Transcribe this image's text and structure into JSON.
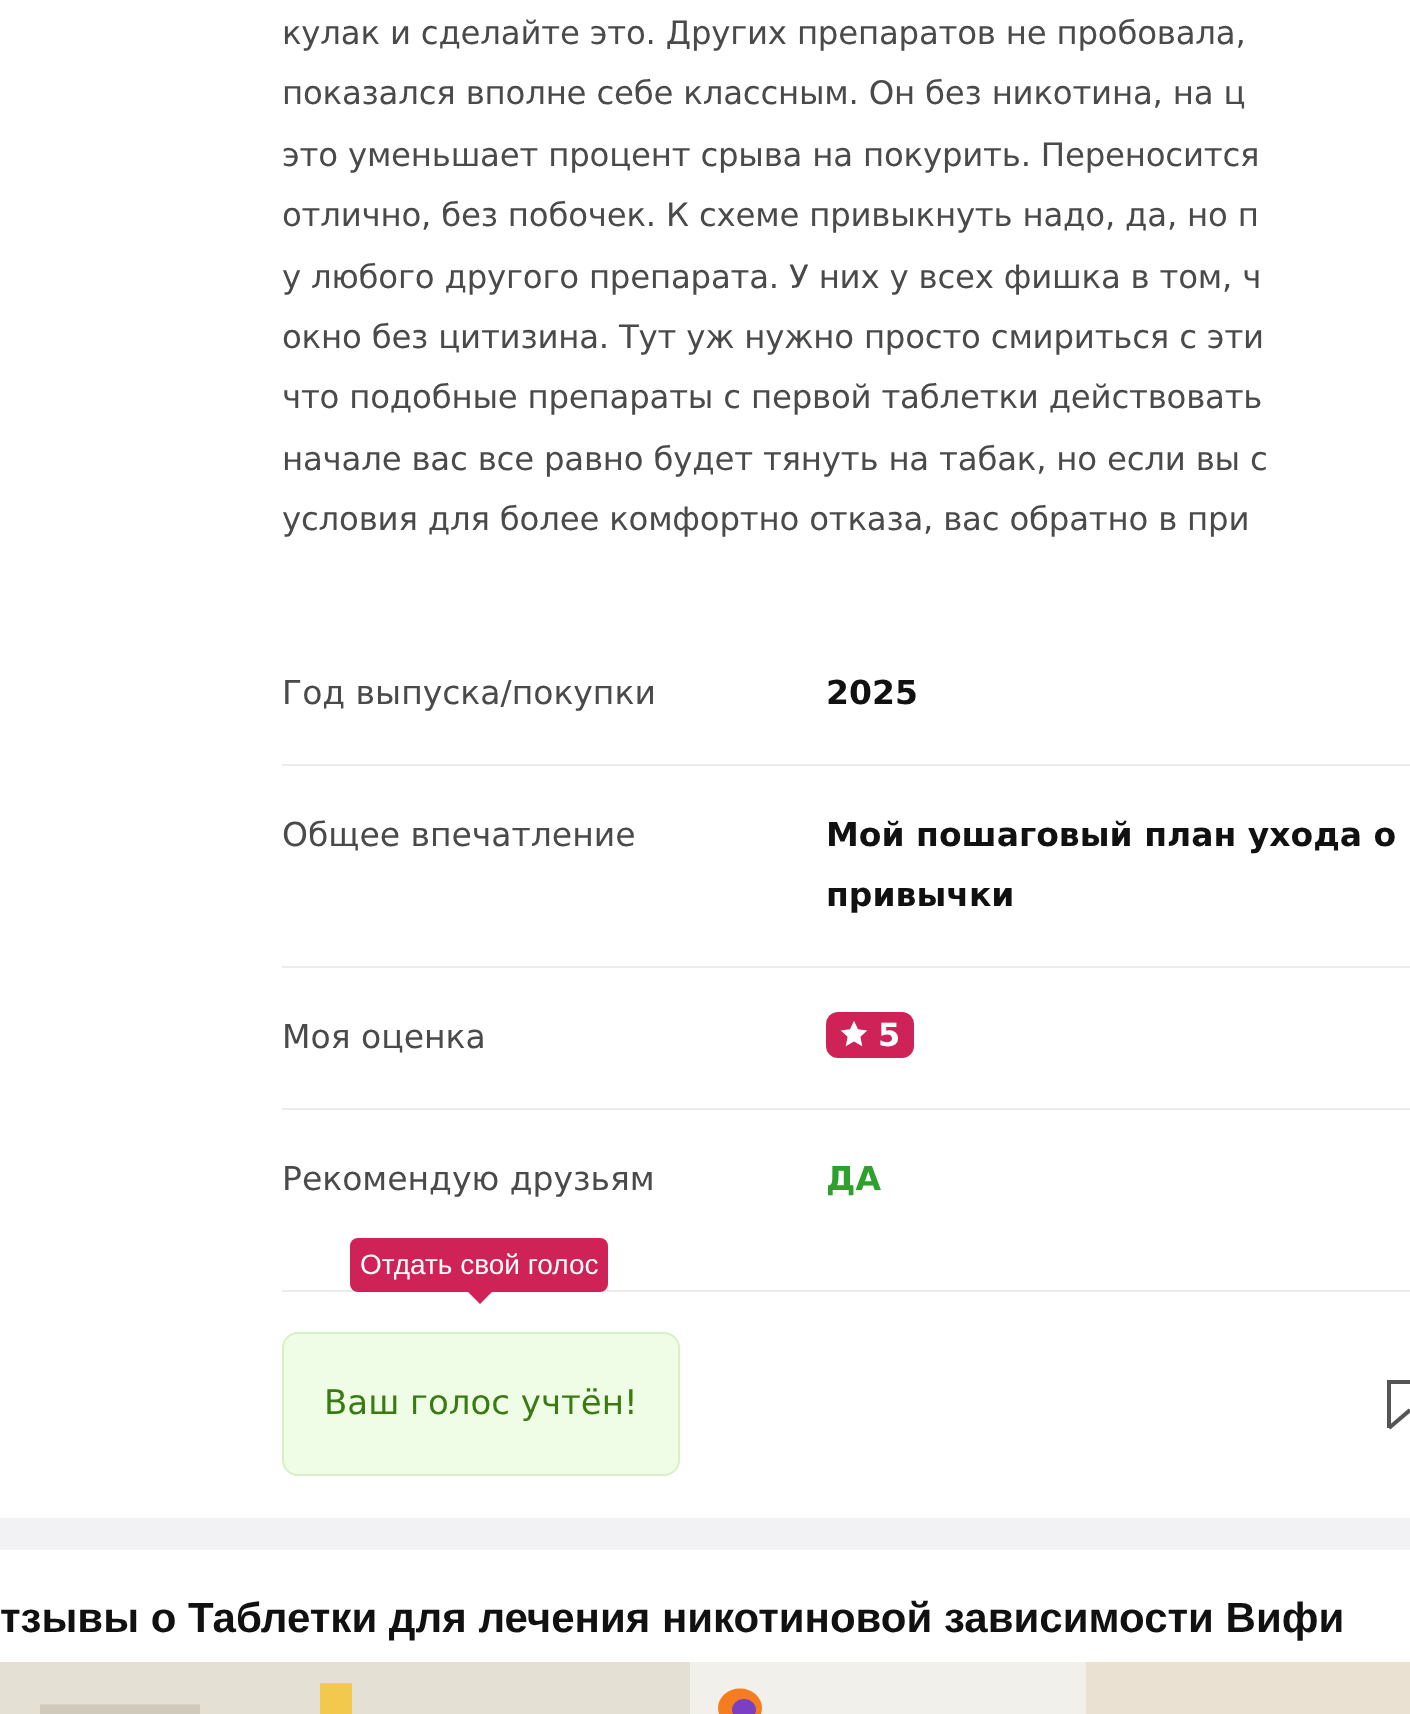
{
  "review": {
    "lines": [
      "кулак и сделайте это. Других препаратов не пробовала,",
      "показался вполне себе классным. Он без никотина, на ц",
      "это уменьшает процент срыва на покурить. Переносится",
      "отлично, без побочек. К схеме привыкнуть надо, да, но п",
      "у любого другого препарата. У них у всех фишка в том, ч",
      "окно без цитизина. Тут уж нужно просто смириться с эти",
      "что подобные препараты с первой таблетки действовать",
      "начале вас все равно будет тянуть на табак, но если вы с",
      "условия для более комфортно отказа, вас обратно в при"
    ]
  },
  "details": [
    {
      "kind": "text",
      "label": "Год выпуска/покупки",
      "value_lines": [
        "2025"
      ]
    },
    {
      "kind": "text",
      "label": "Общее впечатление",
      "value_lines": [
        "Мой пошаговый план ухода о",
        "привычки"
      ]
    },
    {
      "kind": "rating",
      "label": "Моя оценка",
      "value": "5"
    },
    {
      "kind": "recommend",
      "label": "Рекомендую друзьям",
      "value": "ДА"
    }
  ],
  "vote": {
    "tooltip": "Отдать свой голос",
    "message": "Ваш голос учтён!"
  },
  "section": {
    "title": "тзывы о Таблетки для лечения никотиновой зависимости Вифи"
  }
}
